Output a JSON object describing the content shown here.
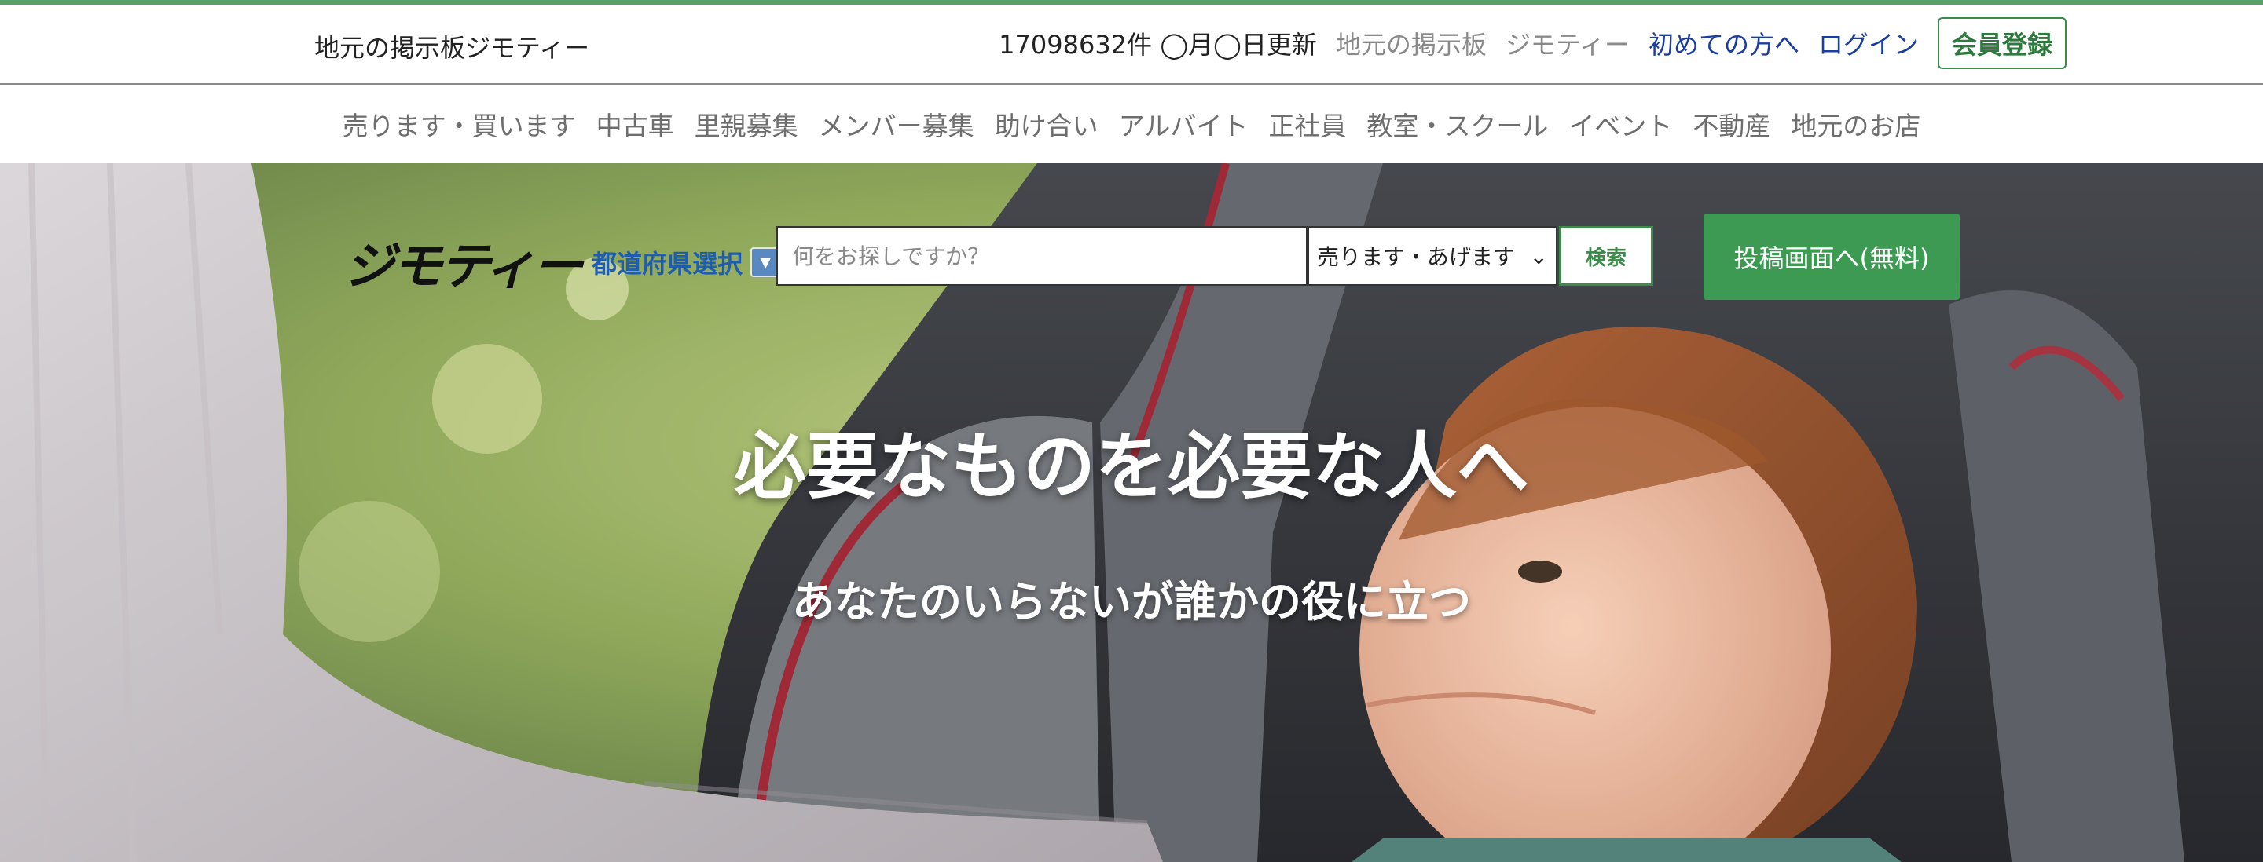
{
  "header": {
    "site_title": "地元の掲示板ジモティー",
    "post_count": "17098632件 ◯月◯日更新",
    "tagline_1": "地元の掲示板",
    "tagline_2": "ジモティー",
    "first_time_link": "初めての方へ",
    "login_link": "ログイン",
    "register_button": "会員登録"
  },
  "categories": [
    "売ります・買います",
    "中古車",
    "里親募集",
    "メンバー募集",
    "助け合い",
    "アルバイト",
    "正社員",
    "教室・スクール",
    "イベント",
    "不動産",
    "地元のお店"
  ],
  "hero": {
    "logo": "ジモティー",
    "prefecture_select": "都道府県選択",
    "search_placeholder": "何をお探しですか？",
    "category_select_value": "売ります・あげます",
    "search_button": "検索",
    "post_button": "投稿画面へ(無料)",
    "headline": "必要なものを必要な人へ",
    "subheadline": "あなたのいらないが誰かの役に立つ"
  },
  "colors": {
    "brand_green": "#3d9a53",
    "link_blue": "#1a3d9e",
    "prefecture_blue": "#1f5db0"
  }
}
